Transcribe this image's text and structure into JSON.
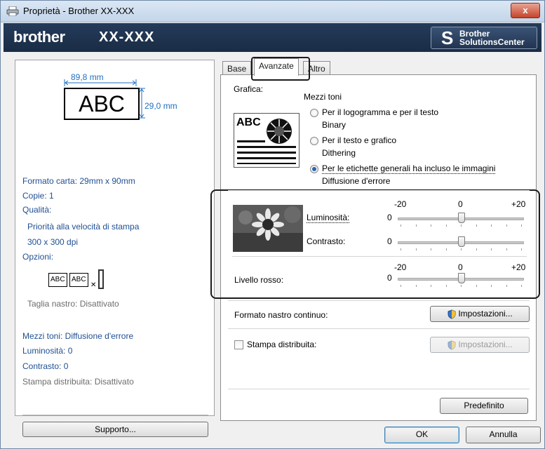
{
  "window": {
    "title": "Proprietà - Brother XX-XXX",
    "close_label": "x"
  },
  "brand": {
    "logo": "brother",
    "model": "XX-XXX",
    "solutions_line1": "Brother",
    "solutions_line2": "SolutionsCenter"
  },
  "preview": {
    "width_label": "89,8 mm",
    "height_label": "29,0 mm",
    "sample_text": "ABC",
    "info": {
      "paper_format": "Formato carta: 29mm x 90mm",
      "copies": "Copie: 1",
      "quality_label": "Qualità:",
      "quality_value": "Priorità alla velocità di stampa",
      "resolution": "300 x 300 dpi",
      "options_label": "Opzioni:",
      "option_sample_1": "ABC",
      "option_sample_2": "ABC",
      "tape_cut": "Taglia nastro: Disattivato",
      "halftone": "Mezzi toni: Diffusione d'errore",
      "brightness": "Luminosità:  0",
      "contrast": "Contrasto:  0",
      "distributed": "Stampa distribuita: Disattivato"
    },
    "support_button": "Supporto..."
  },
  "tabs": [
    {
      "label": "Base",
      "active": false
    },
    {
      "label": "Avanzate",
      "active": true
    },
    {
      "label": "Altro",
      "active": false
    }
  ],
  "advanced": {
    "graphics_label": "Grafica:",
    "halftone_label": "Mezzi toni",
    "graphic_icon_text": "ABC",
    "options": [
      {
        "label": "Per il logogramma e per il testo",
        "sub": "Binary",
        "checked": false
      },
      {
        "label": "Per il testo e grafico",
        "sub": "Dithering",
        "checked": false
      },
      {
        "label": "Per le etichette generali ha incluso le immagini",
        "sub": "Diffusione d'errore",
        "checked": true
      }
    ],
    "scale": {
      "min": "-20",
      "mid": "0",
      "max": "+20"
    },
    "brightness": {
      "label": "Luminosità:",
      "value": "0",
      "level": 0
    },
    "contrast": {
      "label": "Contrasto:",
      "value": "0",
      "level": 0
    },
    "red_level": {
      "label": "Livello rosso:",
      "value": "0",
      "level": 0
    },
    "continuous_tape_label": "Formato nastro continuo:",
    "settings_button": "Impostazioni...",
    "distributed_label": "Stampa distribuita:",
    "distributed_checked": false,
    "settings_button_disabled": "Impostazioni...",
    "default_button": "Predefinito"
  },
  "footer": {
    "ok": "OK",
    "cancel": "Annulla"
  }
}
